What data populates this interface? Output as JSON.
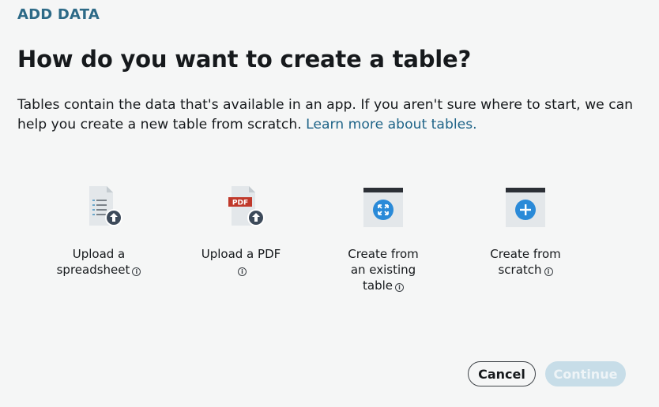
{
  "header": {
    "eyebrow": "ADD DATA",
    "title": "How do you want to create a table?",
    "description": "Tables contain the data that's available in an app. If you aren't sure where to start, we can help you create a new table from scratch. ",
    "learn_more_link": "Learn more about tables."
  },
  "options": [
    {
      "icon": "spreadsheet-upload-icon",
      "label_line1": "Upload a",
      "label_line2": "spreadsheet",
      "label_line3": ""
    },
    {
      "icon": "pdf-upload-icon",
      "badge": "PDF",
      "label_line1": "Upload a PDF",
      "label_line2": "",
      "label_line3": ""
    },
    {
      "icon": "existing-table-icon",
      "label_line1": "Create from",
      "label_line2": "an existing",
      "label_line3": "table"
    },
    {
      "icon": "new-table-icon",
      "label_line1": "Create from",
      "label_line2": "scratch",
      "label_line3": ""
    }
  ],
  "info_glyph": "i",
  "footer": {
    "cancel_label": "Cancel",
    "continue_label": "Continue"
  },
  "colors": {
    "accent": "#2d6a87",
    "link": "#1f6488",
    "icon_blue": "#2a8ad8",
    "upload_badge": "#3d4a5a",
    "pdf_red": "#c0392b",
    "continue_disabled": "#c7dde8"
  }
}
